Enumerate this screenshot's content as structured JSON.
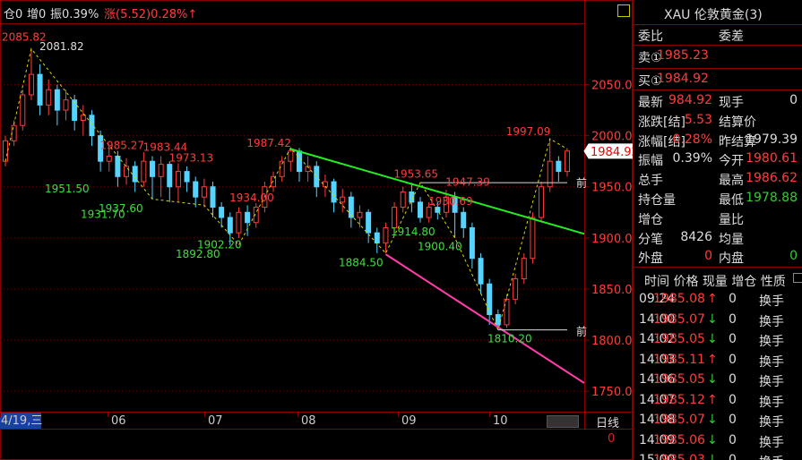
{
  "header": {
    "pos": "仓0",
    "add": "增0",
    "amp": "振0.39%",
    "change": "涨(5.52)0.28%↑"
  },
  "instrument": {
    "title": "XAU 伦敦黄金(3)",
    "weibi_label": "委比",
    "weicha_label": "委差",
    "sell_label": "卖①",
    "sell_value": "1985.23",
    "buy_label": "买①",
    "buy_value": "1984.92",
    "stats": [
      {
        "l1": "最新",
        "v1": "984.92",
        "l2": "现手",
        "v2": "0"
      },
      {
        "l1": "涨跌[结]",
        "v1": "5.53",
        "l2": "结算价",
        "v2": ""
      },
      {
        "l1": "涨幅[结]",
        "v1": "0.28%",
        "l2": "昨结算",
        "v2": "1979.39"
      },
      {
        "l1": "振幅",
        "v1": "0.39%",
        "l2": "今开",
        "v2": "1980.61"
      },
      {
        "l1": "总手",
        "v1": "",
        "l2": "最高",
        "v2": "1986.62"
      },
      {
        "l1": "持仓量",
        "v1": "",
        "l2": "最低",
        "v2": "1978.88"
      },
      {
        "l1": "增仓",
        "v1": "",
        "l2": "量比",
        "v2": ""
      },
      {
        "l1": "分笔",
        "v1": "8426",
        "l2": "均量",
        "v2": ""
      },
      {
        "l1": "外盘",
        "v1": "0",
        "l2": "内盘",
        "v2": "0"
      }
    ],
    "ticks_header": "时间 价格 现量 增仓 性质",
    "ticks": [
      {
        "t": "09:24",
        "p": "1985.08",
        "d": "↑",
        "v": "0",
        "n": "换手"
      },
      {
        "t": "14:00",
        "p": "1985.07",
        "d": "↓",
        "v": "0",
        "n": "换手"
      },
      {
        "t": "14:02",
        "p": "1985.05",
        "d": "↓",
        "v": "0",
        "n": "换手"
      },
      {
        "t": "14:03",
        "p": "1985.11",
        "d": "↑",
        "v": "0",
        "n": "换手"
      },
      {
        "t": "14:06",
        "p": "1985.05",
        "d": "↓",
        "v": "0",
        "n": "换手"
      },
      {
        "t": "14:07",
        "p": "1985.12",
        "d": "↑",
        "v": "0",
        "n": "换手"
      },
      {
        "t": "14:08",
        "p": "1985.07",
        "d": "↓",
        "v": "0",
        "n": "换手"
      },
      {
        "t": "14:09",
        "p": "1985.06",
        "d": "↓",
        "v": "0",
        "n": "换手"
      },
      {
        "t": "15:00",
        "p": "1985.03",
        "d": "↓",
        "v": "0",
        "n": "换手"
      }
    ]
  },
  "chart_data": {
    "type": "candlestick",
    "y_ticks": [
      2050,
      2000,
      1950,
      1900,
      1850,
      1800,
      1750
    ],
    "ylim": [
      1730,
      2110
    ],
    "x_labels": [
      "4/19,三",
      "06",
      "07",
      "08",
      "09",
      "10"
    ],
    "last_price": "1984.92",
    "period": "日线",
    "period_value": "0",
    "peak_labels": [
      {
        "text": "2081.82",
        "v": 2081.82
      },
      {
        "text": "2085.82",
        "v": 2085.82
      },
      {
        "text": "1985.27",
        "v": 1985.27
      },
      {
        "text": "1983.44",
        "v": 1983.44
      },
      {
        "text": "1973.13",
        "v": 1973.13
      },
      {
        "text": "1987.42",
        "v": 1987.42
      },
      {
        "text": "1953.65",
        "v": 1953.65
      },
      {
        "text": "1947.39",
        "v": 1947.39
      },
      {
        "text": "1930.69",
        "v": 1930.69
      },
      {
        "text": "1934.00",
        "v": 1934.0
      },
      {
        "text": "1997.09",
        "v": 1997.09
      }
    ],
    "trough_labels": [
      {
        "text": "1951.50",
        "v": 1951.5
      },
      {
        "text": "1937.60",
        "v": 1937.6
      },
      {
        "text": "1931.70",
        "v": 1931.7
      },
      {
        "text": "1902.20",
        "v": 1902.2
      },
      {
        "text": "1892.80",
        "v": 1892.8
      },
      {
        "text": "1884.50",
        "v": 1884.5
      },
      {
        "text": "1914.80",
        "v": 1914.8
      },
      {
        "text": "1900.40",
        "v": 1900.4
      },
      {
        "text": "1810.20",
        "v": 1810.2
      }
    ],
    "prev_marker": "前",
    "candles": [
      {
        "o": 1975,
        "c": 1995,
        "h": 2000,
        "l": 1970
      },
      {
        "o": 1995,
        "c": 2010,
        "h": 2015,
        "l": 1990
      },
      {
        "o": 2010,
        "c": 2040,
        "h": 2045,
        "l": 2005
      },
      {
        "o": 2040,
        "c": 2060,
        "h": 2085,
        "l": 2035
      },
      {
        "o": 2060,
        "c": 2030,
        "h": 2070,
        "l": 2020
      },
      {
        "o": 2030,
        "c": 2045,
        "h": 2055,
        "l": 2020
      },
      {
        "o": 2045,
        "c": 2025,
        "h": 2050,
        "l": 2010
      },
      {
        "o": 2025,
        "c": 2035,
        "h": 2045,
        "l": 2015
      },
      {
        "o": 2035,
        "c": 2015,
        "h": 2040,
        "l": 2005
      },
      {
        "o": 2015,
        "c": 2020,
        "h": 2030,
        "l": 2000
      },
      {
        "o": 2020,
        "c": 2000,
        "h": 2025,
        "l": 1990
      },
      {
        "o": 2000,
        "c": 1975,
        "h": 2005,
        "l": 1965
      },
      {
        "o": 1975,
        "c": 1980,
        "h": 1990,
        "l": 1965
      },
      {
        "o": 1980,
        "c": 1960,
        "h": 1985,
        "l": 1950
      },
      {
        "o": 1960,
        "c": 1970,
        "h": 1978,
        "l": 1952
      },
      {
        "o": 1970,
        "c": 1955,
        "h": 1975,
        "l": 1945
      },
      {
        "o": 1955,
        "c": 1975,
        "h": 1984,
        "l": 1950
      },
      {
        "o": 1975,
        "c": 1960,
        "h": 1980,
        "l": 1938
      },
      {
        "o": 1960,
        "c": 1972,
        "h": 1980,
        "l": 1940
      },
      {
        "o": 1972,
        "c": 1950,
        "h": 1975,
        "l": 1935
      },
      {
        "o": 1950,
        "c": 1965,
        "h": 1973,
        "l": 1935
      },
      {
        "o": 1965,
        "c": 1955,
        "h": 1970,
        "l": 1945
      },
      {
        "o": 1955,
        "c": 1940,
        "h": 1960,
        "l": 1930
      },
      {
        "o": 1940,
        "c": 1950,
        "h": 1958,
        "l": 1930
      },
      {
        "o": 1950,
        "c": 1930,
        "h": 1955,
        "l": 1920
      },
      {
        "o": 1930,
        "c": 1920,
        "h": 1935,
        "l": 1910
      },
      {
        "o": 1920,
        "c": 1905,
        "h": 1925,
        "l": 1893
      },
      {
        "o": 1905,
        "c": 1925,
        "h": 1930,
        "l": 1900
      },
      {
        "o": 1925,
        "c": 1915,
        "h": 1932,
        "l": 1902
      },
      {
        "o": 1915,
        "c": 1930,
        "h": 1934,
        "l": 1910
      },
      {
        "o": 1930,
        "c": 1950,
        "h": 1955,
        "l": 1925
      },
      {
        "o": 1950,
        "c": 1960,
        "h": 1965,
        "l": 1945
      },
      {
        "o": 1960,
        "c": 1975,
        "h": 1980,
        "l": 1955
      },
      {
        "o": 1975,
        "c": 1985,
        "h": 1988,
        "l": 1965
      },
      {
        "o": 1985,
        "c": 1965,
        "h": 1988,
        "l": 1955
      },
      {
        "o": 1965,
        "c": 1970,
        "h": 1980,
        "l": 1955
      },
      {
        "o": 1970,
        "c": 1950,
        "h": 1975,
        "l": 1940
      },
      {
        "o": 1950,
        "c": 1955,
        "h": 1962,
        "l": 1940
      },
      {
        "o": 1955,
        "c": 1935,
        "h": 1958,
        "l": 1925
      },
      {
        "o": 1935,
        "c": 1940,
        "h": 1948,
        "l": 1925
      },
      {
        "o": 1940,
        "c": 1920,
        "h": 1945,
        "l": 1910
      },
      {
        "o": 1920,
        "c": 1925,
        "h": 1932,
        "l": 1910
      },
      {
        "o": 1925,
        "c": 1905,
        "h": 1928,
        "l": 1895
      },
      {
        "o": 1905,
        "c": 1895,
        "h": 1910,
        "l": 1885
      },
      {
        "o": 1895,
        "c": 1910,
        "h": 1915,
        "l": 1885
      },
      {
        "o": 1910,
        "c": 1930,
        "h": 1935,
        "l": 1905
      },
      {
        "o": 1930,
        "c": 1945,
        "h": 1950,
        "l": 1925
      },
      {
        "o": 1945,
        "c": 1935,
        "h": 1954,
        "l": 1925
      },
      {
        "o": 1935,
        "c": 1920,
        "h": 1940,
        "l": 1915
      },
      {
        "o": 1920,
        "c": 1930,
        "h": 1935,
        "l": 1915
      },
      {
        "o": 1930,
        "c": 1925,
        "h": 1935,
        "l": 1918
      },
      {
        "o": 1925,
        "c": 1940,
        "h": 1947,
        "l": 1920
      },
      {
        "o": 1940,
        "c": 1925,
        "h": 1945,
        "l": 1900
      },
      {
        "o": 1925,
        "c": 1910,
        "h": 1930,
        "l": 1900
      },
      {
        "o": 1910,
        "c": 1880,
        "h": 1915,
        "l": 1870
      },
      {
        "o": 1880,
        "c": 1855,
        "h": 1885,
        "l": 1845
      },
      {
        "o": 1855,
        "c": 1825,
        "h": 1860,
        "l": 1815
      },
      {
        "o": 1825,
        "c": 1815,
        "h": 1830,
        "l": 1810
      },
      {
        "o": 1815,
        "c": 1840,
        "h": 1845,
        "l": 1812
      },
      {
        "o": 1840,
        "c": 1860,
        "h": 1865,
        "l": 1835
      },
      {
        "o": 1860,
        "c": 1880,
        "h": 1885,
        "l": 1855
      },
      {
        "o": 1880,
        "c": 1920,
        "h": 1925,
        "l": 1875
      },
      {
        "o": 1920,
        "c": 1950,
        "h": 1955,
        "l": 1915
      },
      {
        "o": 1950,
        "c": 1975,
        "h": 1997,
        "l": 1945
      },
      {
        "o": 1975,
        "c": 1965,
        "h": 1980,
        "l": 1955
      },
      {
        "o": 1965,
        "c": 1985,
        "h": 1987,
        "l": 1960
      }
    ]
  }
}
